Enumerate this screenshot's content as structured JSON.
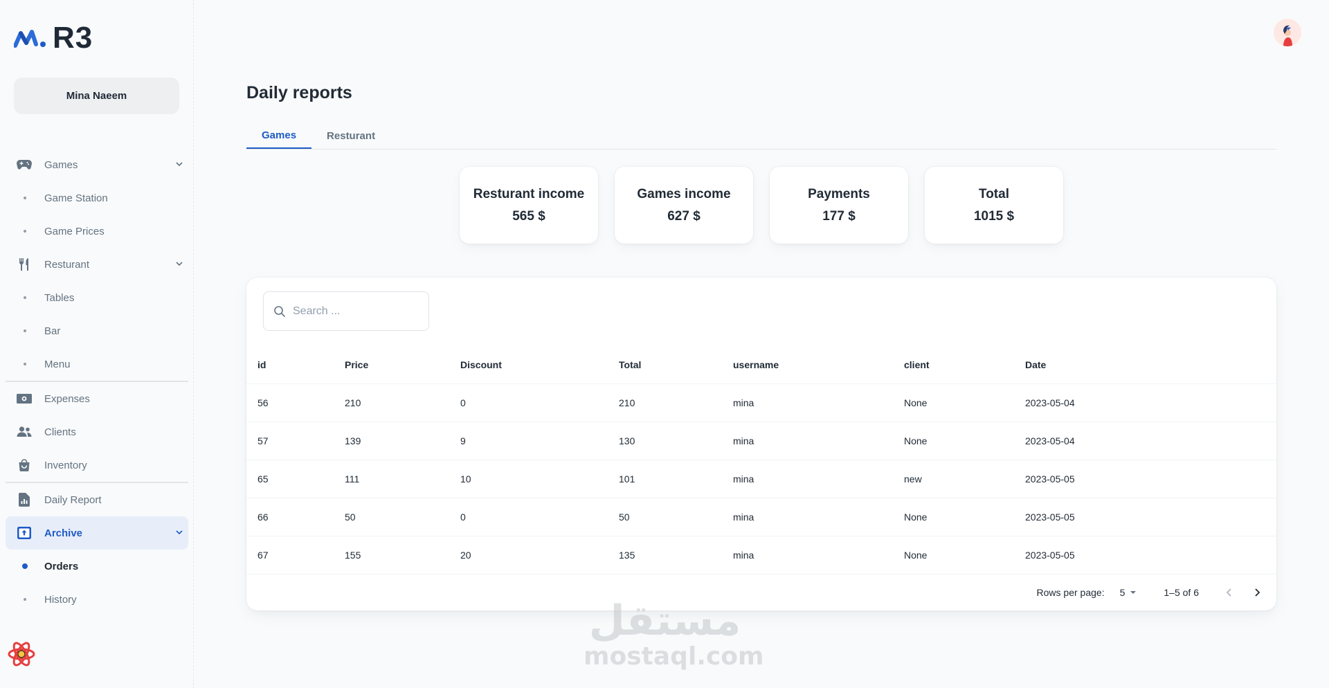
{
  "brand": {
    "name": "R3",
    "accent": "#1e5bc6"
  },
  "user": {
    "name": "Mina Naeem"
  },
  "sidebar": {
    "items": [
      {
        "label": "Games",
        "icon": "gamepad-icon",
        "expanded": true
      },
      {
        "label": "Game Station"
      },
      {
        "label": "Game Prices"
      },
      {
        "label": "Resturant",
        "icon": "cutlery-icon",
        "expanded": true
      },
      {
        "label": "Tables"
      },
      {
        "label": "Bar"
      },
      {
        "label": "Menu"
      },
      {
        "label": "Expenses",
        "icon": "money-icon"
      },
      {
        "label": "Clients",
        "icon": "people-icon"
      },
      {
        "label": "Inventory",
        "icon": "bag-icon"
      },
      {
        "label": "Daily Report",
        "icon": "report-icon"
      },
      {
        "label": "Archive",
        "icon": "archive-icon",
        "expanded": true,
        "active": true
      },
      {
        "label": "Orders",
        "active": true
      },
      {
        "label": "History"
      }
    ]
  },
  "page": {
    "title": "Daily reports",
    "tabs": [
      {
        "label": "Games",
        "active": true
      },
      {
        "label": "Resturant"
      }
    ]
  },
  "cards": [
    {
      "label": "Resturant income",
      "value": "565 $"
    },
    {
      "label": "Games income",
      "value": "627 $"
    },
    {
      "label": "Payments",
      "value": "177 $"
    },
    {
      "label": "Total",
      "value": "1015 $"
    }
  ],
  "search": {
    "placeholder": "Search ..."
  },
  "table": {
    "columns": [
      "id",
      "Price",
      "Discount",
      "Total",
      "username",
      "client",
      "Date"
    ],
    "rows": [
      [
        "56",
        "210",
        "0",
        "210",
        "mina",
        "None",
        "2023-05-04"
      ],
      [
        "57",
        "139",
        "9",
        "130",
        "mina",
        "None",
        "2023-05-04"
      ],
      [
        "65",
        "111",
        "10",
        "101",
        "mina",
        "new",
        "2023-05-05"
      ],
      [
        "66",
        "50",
        "0",
        "50",
        "mina",
        "None",
        "2023-05-05"
      ],
      [
        "67",
        "155",
        "20",
        "135",
        "mina",
        "None",
        "2023-05-05"
      ]
    ]
  },
  "pagination": {
    "rows_per_page_label": "Rows per page:",
    "rows_per_page": "5",
    "range": "1–5 of 6"
  },
  "watermark": {
    "arabic": "مستقل",
    "latin": "mostaql.com"
  }
}
